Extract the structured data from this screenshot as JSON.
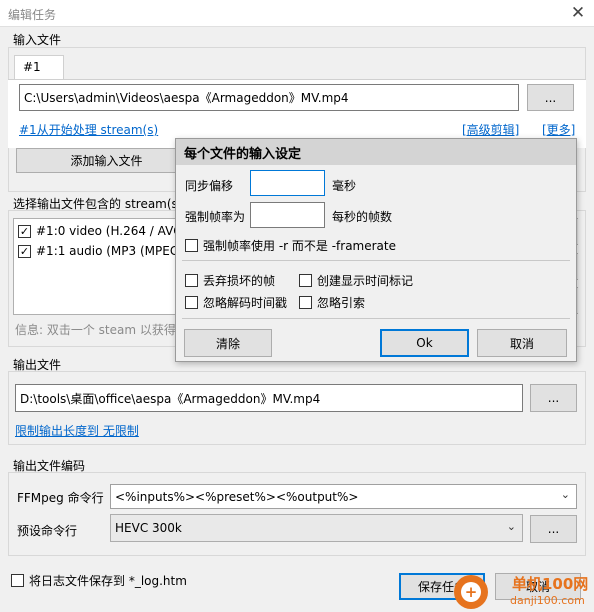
{
  "window": {
    "title": "编辑任务",
    "close_glyph": "✕"
  },
  "input_files": {
    "group_title": "输入文件",
    "tab_label": "#1",
    "path": "C:\\Users\\admin\\Videos\\aespa《Armageddon》MV.mp4",
    "browse_label": "...",
    "start_link": "#1从开始处理 stream(s)",
    "advanced_link": "[高级剪辑]",
    "more_link": "[更多]",
    "add_input_label": "添加输入文件"
  },
  "streams": {
    "group_title": "选择输出文件包含的 stream(s",
    "items": [
      {
        "label": "#1:0 video (H.264 / AVC",
        "checked": true
      },
      {
        "label": "#1:1 audio (MP3 (MPEG",
        "checked": true
      }
    ],
    "info": "信息: 双击一个 steam 以获得"
  },
  "output_file": {
    "group_title": "输出文件",
    "path": "D:\\tools\\桌面\\office\\aespa《Armageddon》MV.mp4",
    "browse_label": "...",
    "limit_link": "限制输出长度到 无限制"
  },
  "encoding": {
    "group_title": "输出文件编码",
    "ffmpeg_label": "FFMpeg 命令行",
    "ffmpeg_value": "<%inputs%><%preset%><%output%>",
    "preset_label": "预设命令行",
    "preset_value": "HEVC 300k",
    "preset_browse": "..."
  },
  "footer": {
    "save_log_label": "将日志文件保存到 *_log.htm",
    "save_task_label": "保存任务",
    "cancel_label": "取消"
  },
  "dialog": {
    "title": "每个文件的输入设定",
    "sync_offset_label": "同步偏移",
    "sync_offset_value": "",
    "sync_offset_unit": "毫秒",
    "force_fps_label": "强制帧率为",
    "force_fps_value": "",
    "force_fps_unit": "每秒的帧数",
    "force_r_label": "强制帧率使用 -r 而不是 -framerate",
    "discard_corrupt": "丢弃损坏的帧",
    "gen_pts": "创建显示时间标记",
    "ignore_dts": "忽略解码时间戳",
    "ignore_index": "忽略引索",
    "clear_label": "清除",
    "ok_label": "Ok",
    "cancel_label": "取消"
  },
  "watermark": {
    "name": "单机100网",
    "url": "danji100.com",
    "icon_char": "+"
  }
}
